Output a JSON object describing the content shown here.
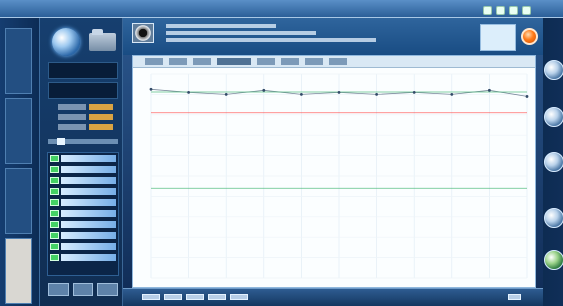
{
  "window": {
    "title": ""
  },
  "icons": {
    "window_lights": [
      "status-light-icon",
      "status-light-icon",
      "status-light-icon",
      "status-light-icon"
    ],
    "left_rail": [
      "vertical-tab",
      "vertical-tab",
      "vertical-tab",
      "vertical-tab"
    ],
    "header": [
      "camera-icon",
      "record-button"
    ],
    "right_rail": [
      "round-control-icon",
      "round-control-icon",
      "round-control-icon",
      "round-control-icon",
      "round-control-icon"
    ]
  },
  "colors": {
    "accent": "#2b5f98",
    "record": "#ff7a18",
    "chart_line_dark": "#465a73",
    "chart_line_green": "#37b26a",
    "chart_line_red": "#ff4b4b"
  },
  "chart_data": {
    "type": "line",
    "title": "",
    "xlabel": "",
    "ylabel": "",
    "xlim": [
      0,
      10
    ],
    "ylim": [
      0,
      100
    ],
    "series": [
      {
        "values": [
          92.5,
          91,
          90,
          92,
          90,
          91,
          90,
          91,
          90,
          92,
          89
        ]
      },
      {
        "values": [
          91.2,
          91.2,
          91.2,
          91.2,
          91.2,
          91.2,
          91.2,
          91.2,
          91.2,
          91.2,
          91.2
        ]
      },
      {
        "values": [
          81,
          81,
          81,
          81,
          81,
          81,
          81,
          81,
          81,
          81,
          81
        ]
      },
      {
        "values": [
          44,
          44,
          44,
          44,
          44,
          44,
          44,
          44,
          44,
          44,
          44
        ]
      }
    ],
    "grid": true
  }
}
